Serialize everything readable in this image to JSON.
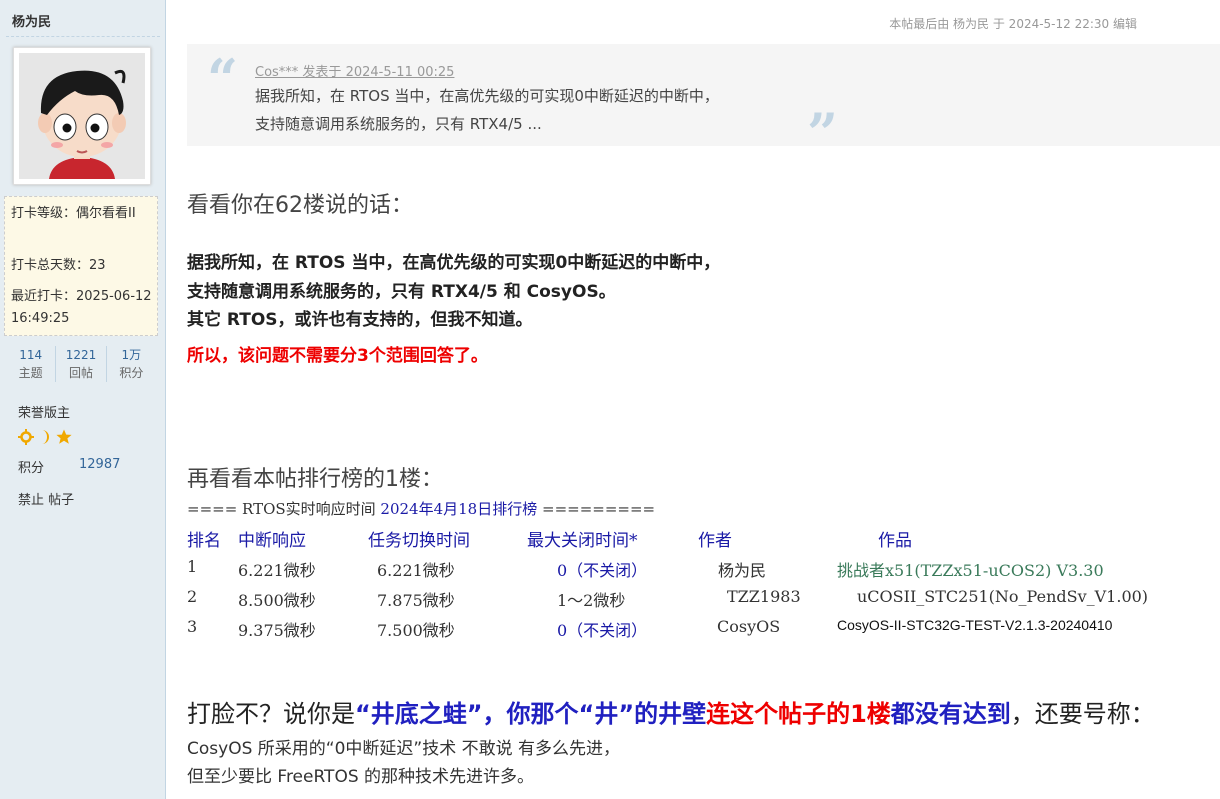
{
  "sidebar": {
    "username": "杨为民",
    "checkin_level": "打卡等级：偶尔看看II",
    "checkin_days": "打卡总天数：23",
    "last_checkin": "最近打卡：2025-06-12 16:49:25",
    "counts": [
      {
        "num": "114",
        "label": "主题"
      },
      {
        "num": "1221",
        "label": "回帖"
      },
      {
        "num": "1万",
        "label": "积分"
      }
    ],
    "group": "荣誉版主",
    "medals": [
      "sun-icon",
      "moon-icon",
      "star-icon"
    ],
    "points_label": "积分",
    "points_value": "12987",
    "ban": "禁止 帖子"
  },
  "post": {
    "edit_note": "本帖最后由 杨为民 于 2024-5-12 22:30 编辑",
    "quote": {
      "header": "Cos*** 发表于 2024-5-11 00:25",
      "line1": "据我所知，在 RTOS 当中，在高优先级的可实现0中断延迟的中断中，",
      "line2": "支持随意调用系统服务的，只有 RTX4/5  ..."
    },
    "heading1": "看看你在62楼说的话：",
    "bold_lines": [
      "据我所知，在 RTOS 当中，在高优先级的可实现0中断延迟的中断中，",
      "支持随意调用系统服务的，只有 RTX4/5 和 CosyOS。",
      "其它 RTOS，或许也有支持的，但我不知道。"
    ],
    "red_line": "所以，该问题不需要分3个范围回答了。",
    "heading2": "再看看本帖排行榜的1楼：",
    "rank_title_a": "==== RTOS实时响应时间 ",
    "rank_title_b": "2024年4月18日排行榜",
    "rank_title_c": " =========",
    "table": {
      "headers": [
        "排名",
        "中断响应",
        "任务切换时间",
        "最大关闭时间*",
        "作者",
        "作品"
      ],
      "rows": [
        {
          "rank": "1",
          "irq": "6.221微秒",
          "switch": "6.221微秒",
          "close": "0（不关闭）",
          "author": "杨为民",
          "work": "挑战者x51(TZZx51-uCOS2) V3.30"
        },
        {
          "rank": "2",
          "irq": "8.500微秒",
          "switch": "7.875微秒",
          "close": "1～2微秒",
          "author": "TZZ1983",
          "work": "uCOSII_STC251(No_PendSv_V1.00)"
        },
        {
          "rank": "3",
          "irq": "9.375微秒",
          "switch": "7.500微秒",
          "close": "0（不关闭）",
          "author": "CosyOS",
          "work": "CosyOS-II-STC32G-TEST-V2.1.3-20240410"
        }
      ]
    },
    "big_line": {
      "p1": "打脸不？说你是",
      "p2": "“井底之蛙”，你那个“井”的井壁",
      "p3": "连这个帖子的1楼",
      "p4": "都没有达到",
      "p5": "，还要号称："
    },
    "last1": "CosyOS 所采用的“0中断延迟”技术 不敢说 有多么先进，",
    "last2": "但至少要比 FreeRTOS 的那种技术先进许多。"
  }
}
